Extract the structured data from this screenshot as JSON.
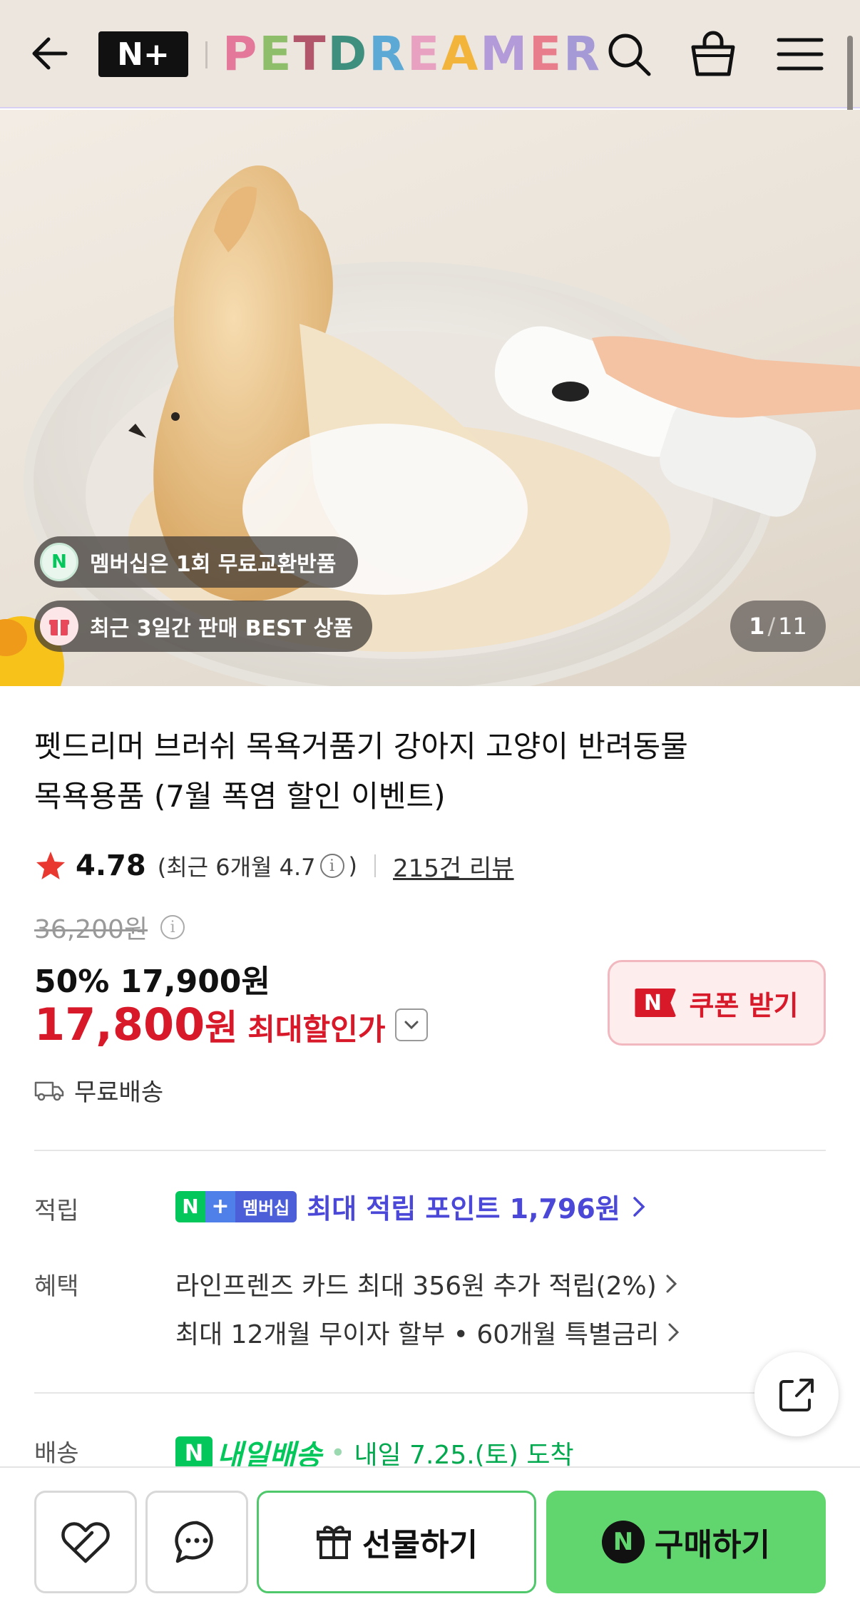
{
  "header": {
    "brand_logo": "N+",
    "brand_name_letters": [
      {
        "ch": "P",
        "color": "#e3789b"
      },
      {
        "ch": "E",
        "color": "#8fbe6a"
      },
      {
        "ch": "T",
        "color": "#b1566b"
      },
      {
        "ch": "D",
        "color": "#3f8f7e"
      },
      {
        "ch": "R",
        "color": "#5da9d6"
      },
      {
        "ch": "E",
        "color": "#e8a1c0"
      },
      {
        "ch": "A",
        "color": "#f2b43a"
      },
      {
        "ch": "M",
        "color": "#b39ad8"
      },
      {
        "ch": "E",
        "color": "#e87d8c"
      },
      {
        "ch": "R",
        "color": "#a69ad6"
      }
    ],
    "icons": [
      "back-arrow-icon",
      "search-icon",
      "shopping-bag-icon",
      "hamburger-menu-icon"
    ]
  },
  "hero": {
    "badge_membership": "멤버십은 1회 무료교환반품",
    "badge_membership_icon": "N",
    "badge_best": "최근 3일간 판매 BEST 상품",
    "counter_current": "1",
    "counter_sep": "/",
    "counter_total": "11"
  },
  "product": {
    "title_line1": "펫드리머 브러쉬 목욕거품기 강아지 고양이 반려동물",
    "title_line2": "목욕용품 (7월 폭염 할인 이벤트)",
    "rating": "4.78",
    "rating_recent_prefix": "(최근 6개월 4.7",
    "rating_recent_suffix": ")",
    "info_glyph": "i",
    "review_count": "215건 리뷰",
    "original_price": "36,200원",
    "discount_line": "50% 17,900원",
    "final_price": "17,800",
    "final_unit": "원",
    "final_label": "최대할인가",
    "coupon_icon": "N",
    "coupon_label": "쿠폰 받기",
    "delivery_text": "무료배송"
  },
  "benefits": {
    "points_label": "적립",
    "membership_badge_n": "N",
    "membership_badge_plus": "+",
    "membership_badge_text": "멤버십",
    "points_text": "최대 적립 포인트 1,796원",
    "benefit_label": "혜택",
    "benefit_line1": "라인프렌즈 카드 최대 356원 추가 적립(2%)",
    "benefit_line2": "최대 12개월 무이자 할부 • 60개월 특별금리",
    "shipping_label": "배송",
    "shipping_n": "N",
    "shipping_brand": "내일배송",
    "shipping_dot": "•",
    "shipping_date": "내일 7.25.(토) 도착"
  },
  "bottom_bar": {
    "gift_label": "선물하기",
    "buy_icon": "N",
    "buy_label": "구매하기"
  },
  "colors": {
    "header_bg": "#ece6df",
    "sale_red": "#d8192a",
    "naver_green": "#03c75a",
    "buy_green": "#62d66e",
    "membership_purple": "#4b48d8"
  }
}
